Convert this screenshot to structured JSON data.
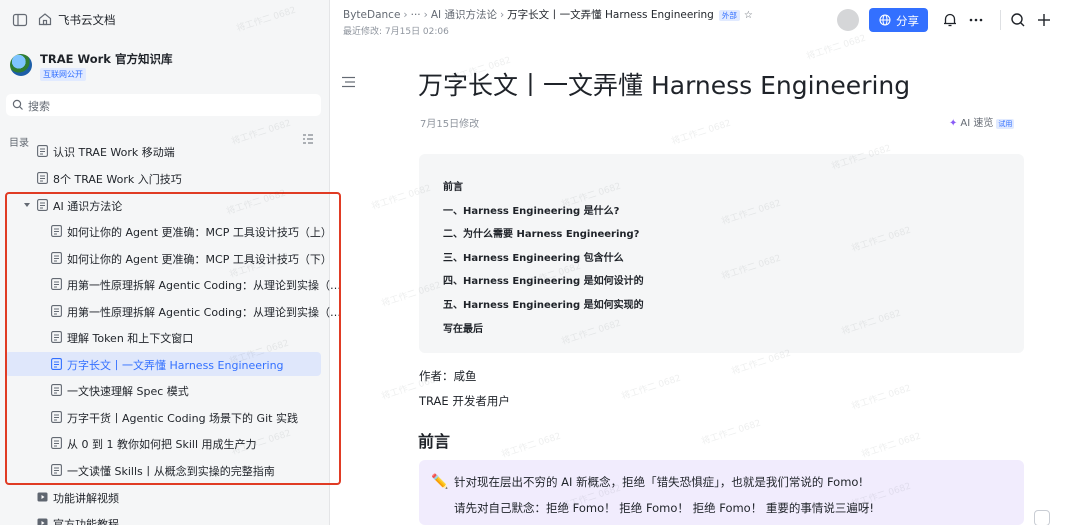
{
  "sidebar": {
    "brand": "飞书云文档",
    "space_title": "TRAE Work 官方知识库",
    "space_badge": "互联网公开",
    "search_placeholder": "搜索",
    "toc_label": "目录",
    "items": [
      {
        "label": "认识 TRAE Work 移动端",
        "level": 1,
        "active": false
      },
      {
        "label": "8个 TRAE Work 入门技巧",
        "level": 1,
        "active": false
      },
      {
        "label": "AI 通识方法论",
        "level": 1,
        "active": false,
        "expanded": true
      },
      {
        "label": "如何让你的 Agent 更准确：MCP 工具设计技巧（上）",
        "level": 2,
        "active": false
      },
      {
        "label": "如何让你的 Agent 更准确：MCP 工具设计技巧（下）",
        "level": 2,
        "active": false
      },
      {
        "label": "用第一性原理拆解 Agentic Coding：从理论到实操（…",
        "level": 2,
        "active": false
      },
      {
        "label": "用第一性原理拆解 Agentic Coding：从理论到实操（…",
        "level": 2,
        "active": false
      },
      {
        "label": "理解 Token 和上下文窗口",
        "level": 2,
        "active": false
      },
      {
        "label": "万字长文丨一文弄懂 Harness Engineering",
        "level": 2,
        "active": true
      },
      {
        "label": "一文快速理解 Spec 模式",
        "level": 2,
        "active": false
      },
      {
        "label": "万字干货丨Agentic Coding 场景下的 Git 实践",
        "level": 2,
        "active": false
      },
      {
        "label": "从 0 到 1 教你如何把 Skill 用成生产力",
        "level": 2,
        "active": false
      },
      {
        "label": "一文读懂 Skills丨从概念到实操的完整指南",
        "level": 2,
        "active": false
      },
      {
        "label": "功能讲解视频",
        "level": 1,
        "active": false,
        "icon": "video"
      },
      {
        "label": "官方功能教程",
        "level": 1,
        "active": false,
        "icon": "video"
      }
    ]
  },
  "header": {
    "breadcrumb": [
      "ByteDance",
      "···",
      "AI 通识方法论",
      "万字长文丨一文弄懂 Harness Engineering"
    ],
    "external_badge": "外部",
    "modified": "最近修改: 7月15日 02:06",
    "share_label": "分享"
  },
  "document": {
    "title": "万字长文丨一文弄懂 Harness Engineering",
    "date": "7月15日修改",
    "ai_quick": "AI 速览",
    "ai_badge": "试用",
    "toc": [
      "前言",
      "一、Harness Engineering 是什么?",
      "二、为什么需要 Harness Engineering?",
      "三、Harness Engineering 包含什么",
      "四、Harness Engineering 是如何设计的",
      "五、Harness Engineering 是如何实现的",
      "写在最后"
    ],
    "author": "作者：咸鱼",
    "author_role": "TRAE 开发者用户",
    "section_heading": "前言",
    "callout_lines": [
      "针对现在层出不穷的 AI 新概念，拒绝「错失恐惧症」，也就是我们常说的 Fomo!",
      "请先对自己默念：拒绝 Fomo！ 拒绝 Fomo！ 拒绝 Fomo！ 重要的事情说三遍呀!"
    ]
  },
  "colors": {
    "accent": "#3370ff",
    "highlight_border": "#e03b24",
    "callout_bg": "#f1ecfd"
  }
}
